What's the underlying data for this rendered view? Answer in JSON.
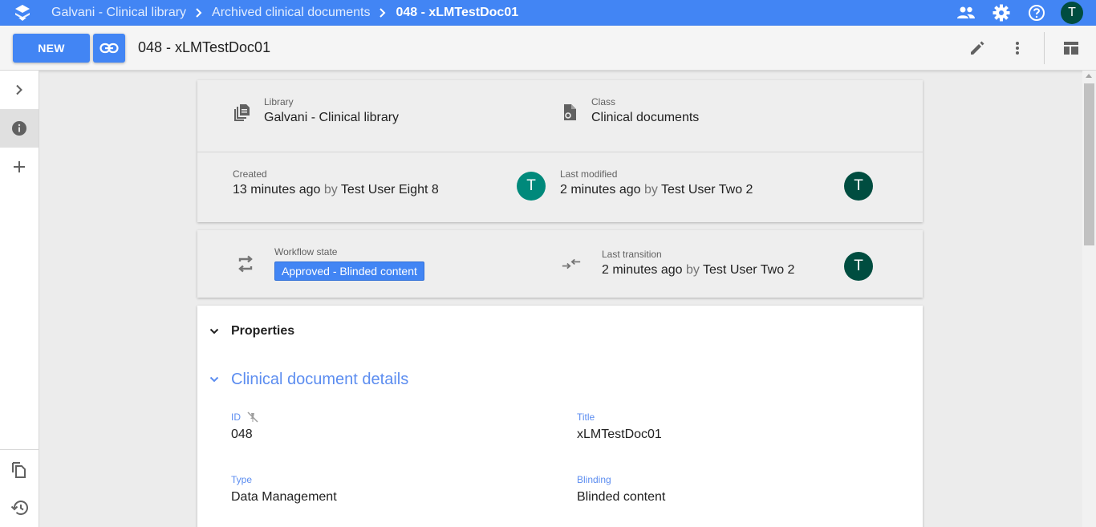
{
  "breadcrumb": {
    "items": [
      "Galvani - Clinical library",
      "Archived clinical documents"
    ],
    "current": "048 - xLMTestDoc01"
  },
  "topbar": {
    "avatar_initial": "T",
    "icons": [
      "people-icon",
      "settings-icon",
      "help-icon"
    ]
  },
  "toolbar": {
    "new_label": "NEW",
    "doc_title": "048 - xLMTestDoc01"
  },
  "info": {
    "library_label": "Library",
    "library_value": "Galvani - Clinical library",
    "class_label": "Class",
    "class_value": "Clinical documents",
    "created_label": "Created",
    "created_time": "13 minutes ago",
    "created_by_word": "by",
    "created_by": "Test User Eight 8",
    "created_avatar": "T",
    "modified_label": "Last modified",
    "modified_time": "2 minutes ago",
    "modified_by_word": "by",
    "modified_by": "Test User Two 2",
    "modified_avatar": "T"
  },
  "workflow": {
    "state_label": "Workflow state",
    "state_value": "Approved - Blinded content",
    "transition_label": "Last transition",
    "transition_time": "2 minutes ago",
    "transition_by_word": "by",
    "transition_by": "Test User Two 2",
    "transition_avatar": "T"
  },
  "properties": {
    "title": "Properties",
    "section_title": "Clinical document details",
    "fields": [
      {
        "label": "ID",
        "value": "048"
      },
      {
        "label": "Title",
        "value": "xLMTestDoc01"
      },
      {
        "label": "Type",
        "value": "Data Management"
      },
      {
        "label": "Blinding",
        "value": "Blinded content"
      }
    ]
  },
  "colors": {
    "accent": "#4285f4",
    "avatar_teal": "#00897b",
    "avatar_dark": "#004d40",
    "section_blue": "#5c8df0"
  }
}
